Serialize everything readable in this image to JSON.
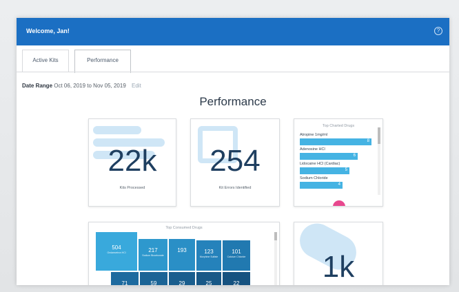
{
  "header": {
    "welcome": "Welcome, Jan!"
  },
  "tabs": [
    {
      "label": "Active Kits",
      "active": false
    },
    {
      "label": "Performance",
      "active": true
    }
  ],
  "date_range": {
    "label": "Date Range",
    "value": "Oct 06, 2019 to Nov 05, 2019",
    "edit": "Edit"
  },
  "page_title": "Performance",
  "cards": {
    "kits_processed": {
      "value": "22k",
      "label": "Kits Processed"
    },
    "kit_errors": {
      "value": "254",
      "label": "Kit Errors Identified"
    },
    "top_charted": {
      "title": "Top Charted Drugs",
      "items": [
        {
          "name": "Atropine 1mg/ml",
          "count": "8",
          "fraction": 1.0
        },
        {
          "name": "Adenosine HCl",
          "count": "6",
          "fraction": 0.78
        },
        {
          "name": "Lidocaine HCl (Cardiac)",
          "count": "5",
          "fraction": 0.65
        },
        {
          "name": "Sodium Chloride",
          "count": "4",
          "fraction": 0.52
        }
      ]
    },
    "top_consumed": {
      "title": "Top Consumed Drugs",
      "cells": [
        {
          "value": "504",
          "sub": "Ondansetron HCl"
        },
        {
          "value": "217",
          "sub": "Sodium Bicarbonate"
        },
        {
          "value": "193",
          "sub": ""
        },
        {
          "value": "123",
          "sub": "Morphine Sulfate"
        },
        {
          "value": "101",
          "sub": "Calcium Chloride"
        },
        {
          "value": "71",
          "sub": ""
        },
        {
          "value": "59",
          "sub": ""
        },
        {
          "value": "29",
          "sub": ""
        },
        {
          "value": "25",
          "sub": ""
        },
        {
          "value": "22",
          "sub": ""
        }
      ]
    },
    "fourth": {
      "value": "1k"
    }
  },
  "colors": {
    "header": "#1b6fc3",
    "bar": "#45b3e3",
    "value": "#1f3f60"
  }
}
